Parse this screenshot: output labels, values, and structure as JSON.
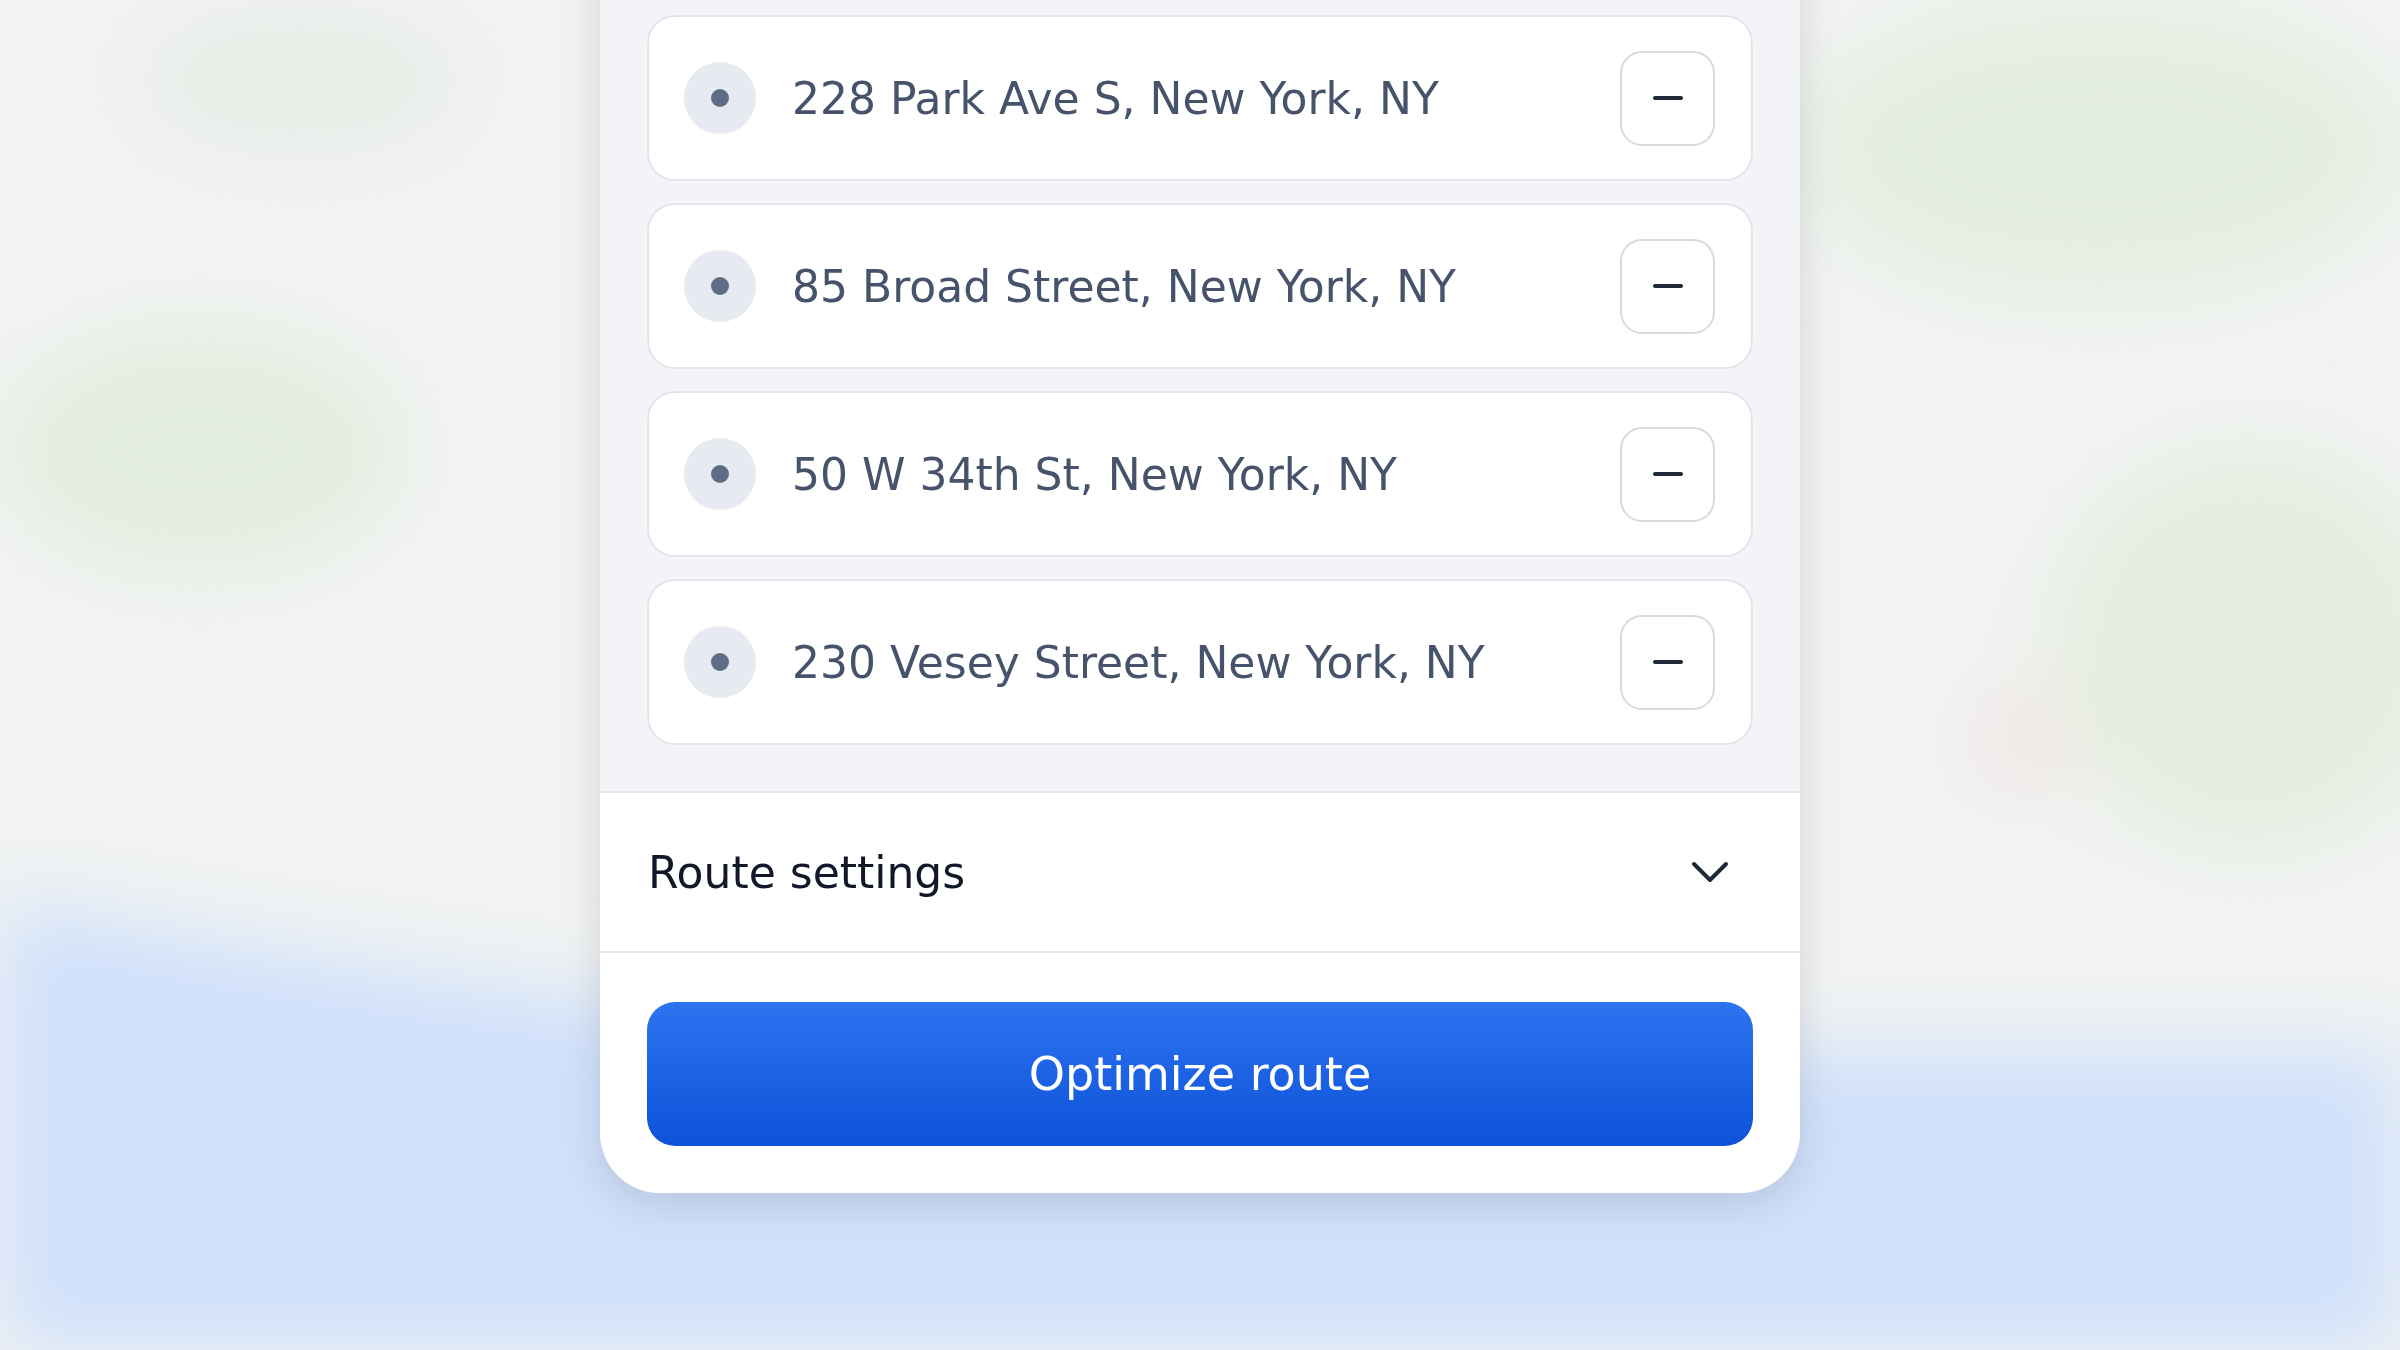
{
  "stops": [
    {
      "address": "228 Park Ave S, New York, NY"
    },
    {
      "address": "85 Broad Street, New York, NY"
    },
    {
      "address": "50 W 34th St, New York, NY"
    },
    {
      "address": "230 Vesey Street, New York, NY"
    }
  ],
  "route_settings": {
    "label": "Route settings",
    "expanded": false
  },
  "primary_button": {
    "label": "Optimize route"
  }
}
